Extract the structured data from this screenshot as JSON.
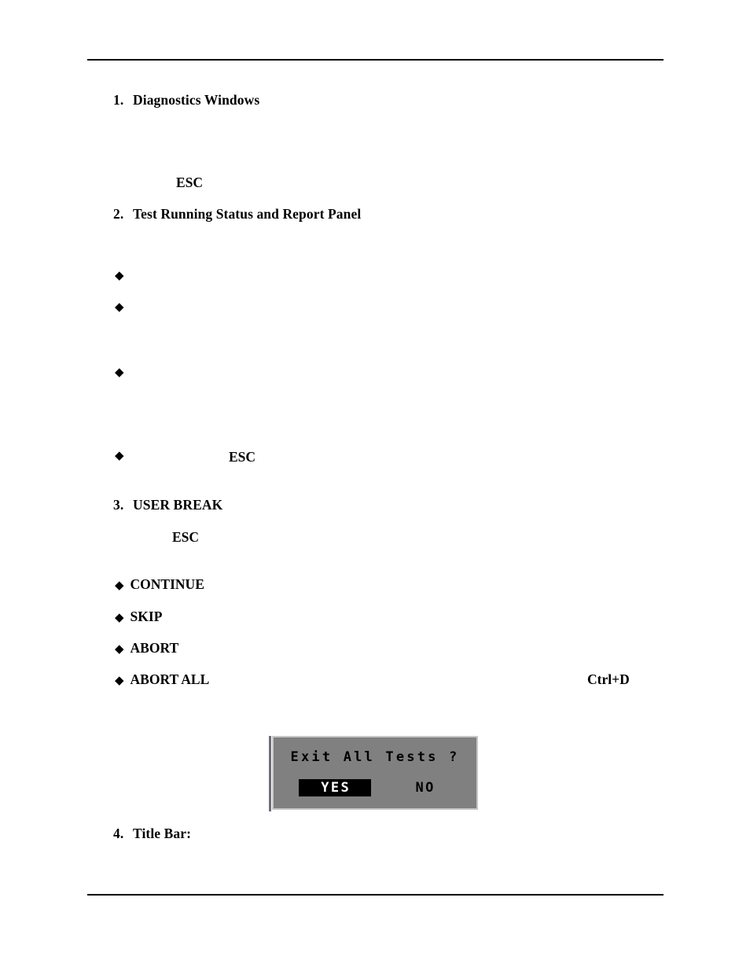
{
  "page": {
    "background_color": "#ffffff",
    "text_color": "#000000"
  },
  "rules": {
    "header_present": true,
    "footer_present": true
  },
  "sections": [
    {
      "number": "1.",
      "title": "Diagnostics Windows"
    },
    {
      "number": "2.",
      "title": "Test Running Status and Report Panel"
    },
    {
      "number": "3.",
      "title": "USER BREAK"
    },
    {
      "number": "4.",
      "title": "Title Bar:"
    }
  ],
  "inline_terms": {
    "esc_section1": "ESC",
    "esc_section2_bullet": "ESC",
    "esc_section3": "ESC",
    "ctrl_d": "Ctrl+D"
  },
  "bullets": {
    "glyph": "◆",
    "section2": [
      {
        "label": ""
      },
      {
        "label": ""
      },
      {
        "label": ""
      },
      {
        "label": ""
      }
    ],
    "section3": [
      {
        "label": "CONTINUE"
      },
      {
        "label": "SKIP"
      },
      {
        "label": "ABORT"
      },
      {
        "label": "ABORT ALL"
      }
    ]
  },
  "dialog": {
    "title": "Exit All Tests ?",
    "buttons": [
      {
        "label": "YES",
        "selected": true
      },
      {
        "label": "NO",
        "selected": false
      }
    ],
    "background_color": "#808080",
    "border_color": "#c6c6c6",
    "selected_bg_color": "#000000",
    "selected_text_color": "#ffffff"
  }
}
